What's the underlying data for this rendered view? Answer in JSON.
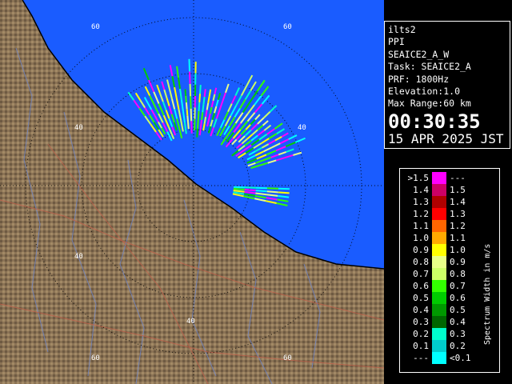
{
  "info": {
    "site": "ilts2",
    "mode": "PPI",
    "scan": "SEAICE2_A_W",
    "task": "Task: SEAICE2_A",
    "prf": "PRF: 1800Hz",
    "elevation": "Elevation:1.0",
    "max_range": "Max Range:60 km",
    "time": "00:30:35",
    "date": "15 APR 2025 JST"
  },
  "legend": {
    "title": "Spectrum Width in m/s",
    "rows": [
      {
        "left": ">1.5",
        "right": "---",
        "color": "#ff00ff"
      },
      {
        "left": "1.4",
        "right": "1.5",
        "color": "#cc0066"
      },
      {
        "left": "1.3",
        "right": "1.4",
        "color": "#b00000"
      },
      {
        "left": "1.2",
        "right": "1.3",
        "color": "#ff0000"
      },
      {
        "left": "1.1",
        "right": "1.2",
        "color": "#ff6600"
      },
      {
        "left": "1.0",
        "right": "1.1",
        "color": "#ffaa00"
      },
      {
        "left": "0.9",
        "right": "1.0",
        "color": "#ffff00"
      },
      {
        "left": "0.8",
        "right": "0.9",
        "color": "#e8ff88"
      },
      {
        "left": "0.7",
        "right": "0.8",
        "color": "#ccff66"
      },
      {
        "left": "0.6",
        "right": "0.7",
        "color": "#33ff00"
      },
      {
        "left": "0.5",
        "right": "0.6",
        "color": "#00cc00"
      },
      {
        "left": "0.4",
        "right": "0.5",
        "color": "#009900"
      },
      {
        "left": "0.3",
        "right": "0.4",
        "color": "#006600"
      },
      {
        "left": "0.2",
        "right": "0.3",
        "color": "#00ffcc"
      },
      {
        "left": "0.1",
        "right": "0.2",
        "color": "#00cccc"
      },
      {
        "left": "---",
        "right": "<0.1",
        "color": "#00ffff"
      }
    ]
  },
  "map": {
    "sea_color": "#1a5cff",
    "land_color": "#8b7355",
    "range_labels": [
      "60",
      "40",
      "40",
      "40",
      "60",
      "40",
      "60",
      "60"
    ]
  }
}
